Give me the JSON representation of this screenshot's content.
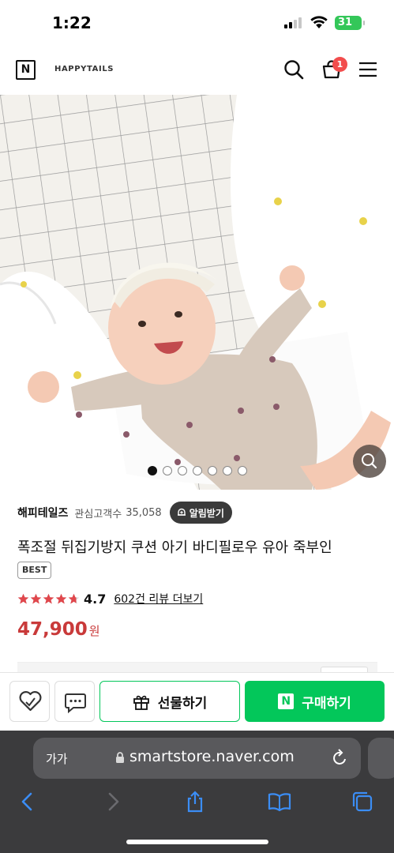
{
  "status_bar": {
    "time": "1:22",
    "battery": "31"
  },
  "header": {
    "logo_letter": "N",
    "store_name": "HAPPYTAILS",
    "cart_count": "1",
    "icons": [
      "search-icon",
      "cart-icon",
      "menu-icon"
    ]
  },
  "gallery": {
    "total_images": 7,
    "active_index": 0
  },
  "product": {
    "brand": "해피테일즈",
    "interest_label": "관심고객수",
    "interest_count": "35,058",
    "notify_label": "알림받기",
    "title": "폭조절 뒤집기방지 쿠션 아기 바디필로우 유아 죽부인",
    "badge": "BEST",
    "rating": "4.7",
    "review_link": "602건 리뷰 더보기",
    "price": "47,900",
    "price_unit": "원"
  },
  "actions": {
    "gift_label": "선물하기",
    "buy_label": "구매하기",
    "buy_logo": "N"
  },
  "safari": {
    "text_size": "가가",
    "url": "smartstore.naver.com"
  },
  "colors": {
    "naver_green": "#03c75a",
    "price_red": "#c93a3a",
    "badge_red": "#f24d4d",
    "star_red": "#e0474c"
  }
}
